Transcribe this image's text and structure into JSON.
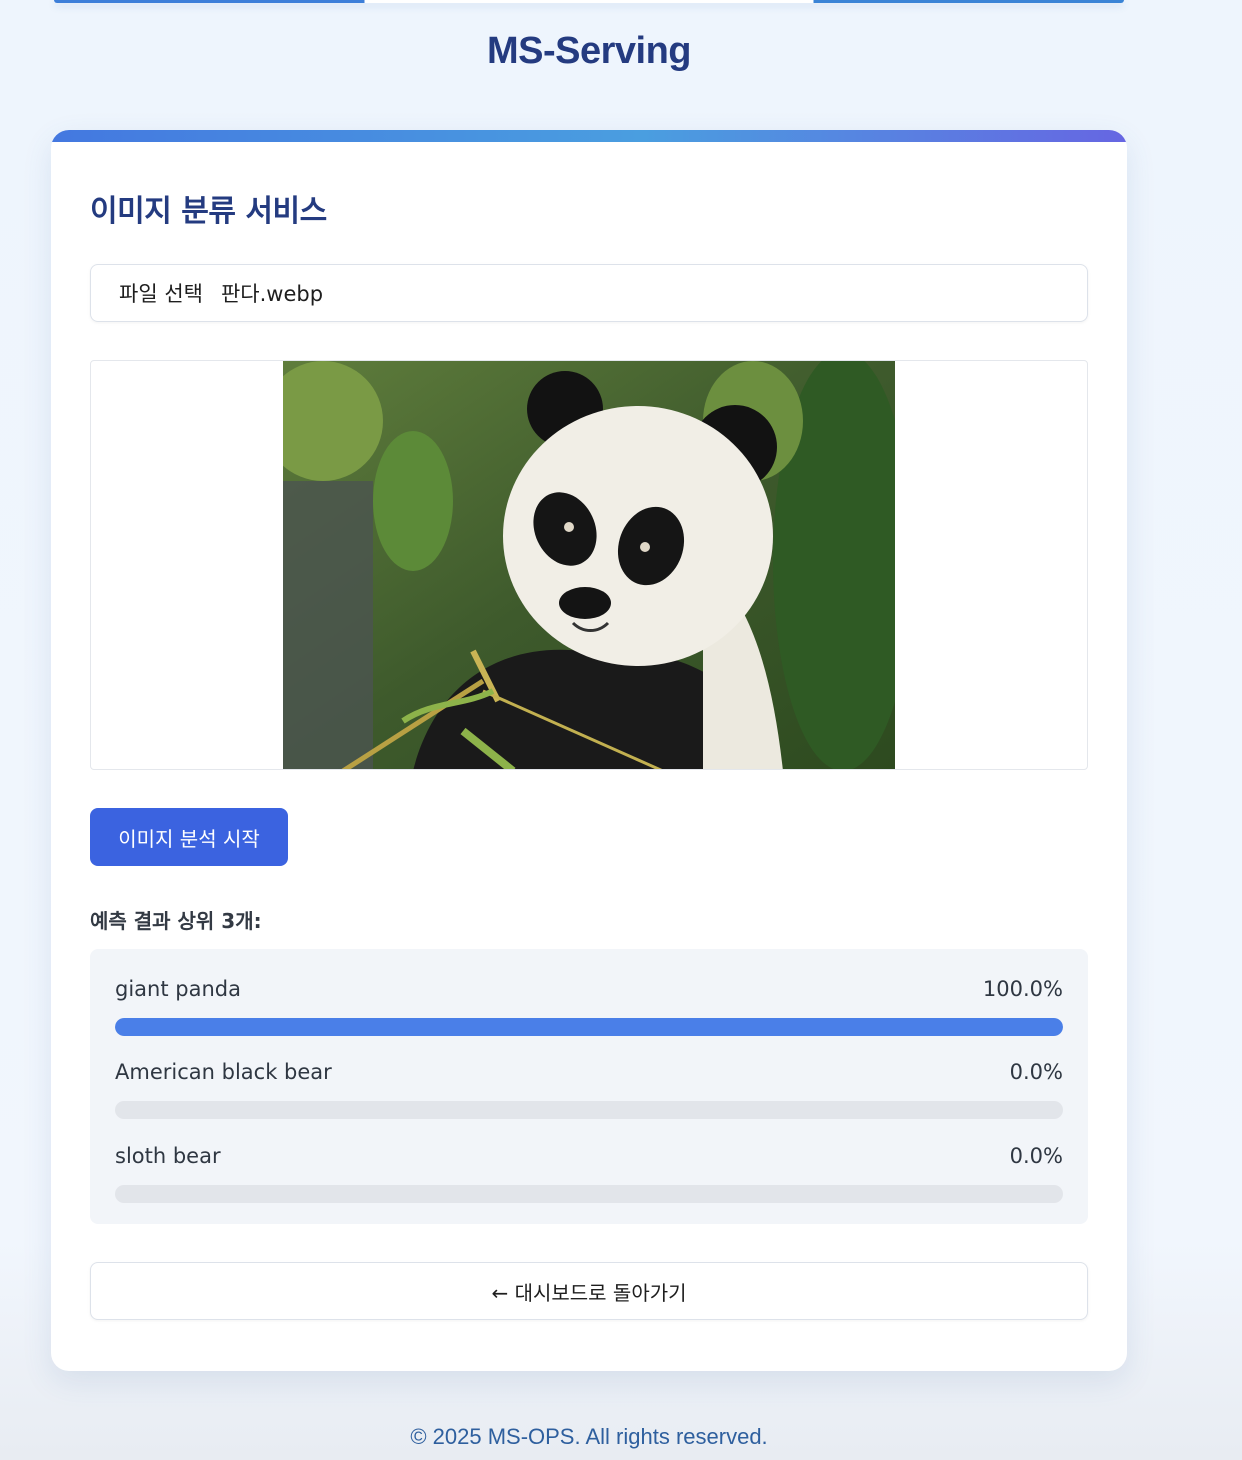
{
  "app": {
    "title": "MS-Serving"
  },
  "card": {
    "title": "이미지 분류 서비스",
    "file_button_label": "파일 선택",
    "file_name": "판다.webp",
    "analyze_button_label": "이미지 분석 시작",
    "results_label": "예측 결과 상위 3개:",
    "back_button_label": "← 대시보드로 돌아가기"
  },
  "predictions": [
    {
      "label": "giant panda",
      "percent_text": "100.0%",
      "value": 1.0
    },
    {
      "label": "American black bear",
      "percent_text": "0.0%",
      "value": 0.0
    },
    {
      "label": "sloth bear",
      "percent_text": "0.0%",
      "value": 0.0
    }
  ],
  "footer": {
    "text": "© 2025 MS-OPS. All rights reserved."
  },
  "colors": {
    "primary": "#3b63e0",
    "title": "#243b80",
    "progress_fill": "#4a7fe8",
    "progress_track": "#e2e5ea"
  }
}
